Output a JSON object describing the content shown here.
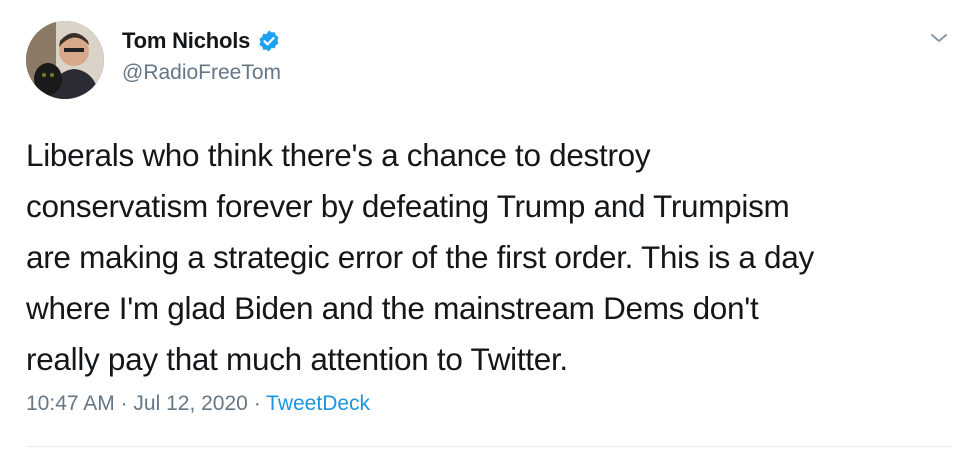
{
  "author": {
    "display_name": "Tom Nichols",
    "handle": "@RadioFreeTom",
    "verified": true
  },
  "tweet": {
    "lines": [
      "Liberals who think there's a chance to destroy",
      "conservatism forever by defeating Trump and Trumpism",
      "are making a strategic error of the first order. This is a day",
      "where I'm glad Biden and the mainstream Dems don't",
      "really pay that much attention to Twitter."
    ],
    "time": "10:47 AM",
    "date": "Jul 12, 2020",
    "separator": "·",
    "source": "TweetDeck"
  },
  "icons": {
    "verified": "verified-badge-icon",
    "menu": "chevron-down-icon"
  },
  "colors": {
    "accent": "#1da1f2",
    "source_link": "#1b95e0",
    "secondary_text": "#657786",
    "primary_text": "#14171a"
  }
}
